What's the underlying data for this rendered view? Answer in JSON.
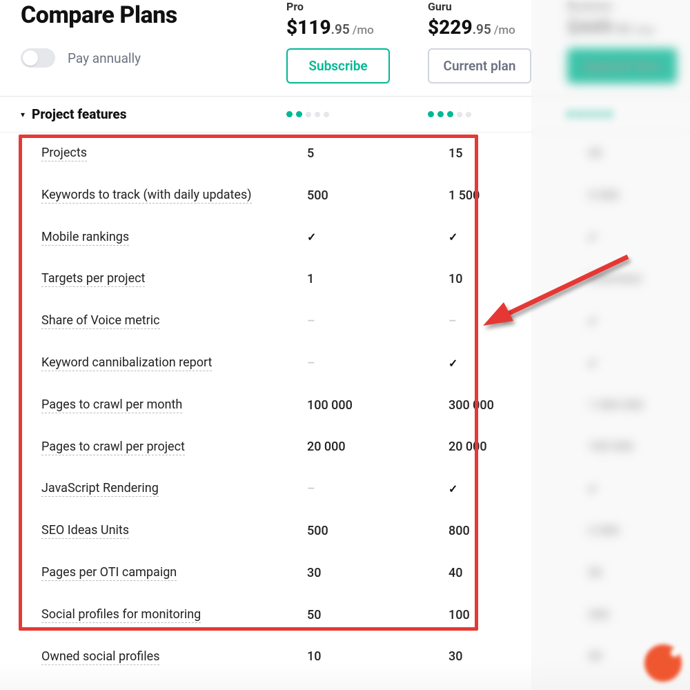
{
  "title": "Compare Plans",
  "annual_toggle_label": "Pay annually",
  "plans": {
    "pro": {
      "name": "Pro",
      "price_main": "$119",
      "price_cents": ".95",
      "period": "/mo",
      "button": "Subscribe",
      "dots_on": 2,
      "dots_total": 5
    },
    "guru": {
      "name": "Guru",
      "price_main": "$229",
      "price_cents": ".95",
      "period": "/mo",
      "button": "Current plan",
      "dots_on": 3,
      "dots_total": 5
    },
    "business": {
      "name": "Business",
      "price_main": "$449",
      "price_cents": ".95",
      "period": "/mo",
      "button": "Upgrade Now",
      "dots_on": 5,
      "dots_total": 5
    }
  },
  "section_title": "Project features",
  "features": [
    {
      "label": "Projects",
      "pro": "5",
      "guru": "15",
      "business": "40"
    },
    {
      "label": "Keywords to track (with daily updates)",
      "pro": "500",
      "guru": "1 500",
      "business": "5 000"
    },
    {
      "label": "Mobile rankings",
      "pro": "check",
      "guru": "check",
      "business": "check"
    },
    {
      "label": "Targets per project",
      "pro": "1",
      "guru": "10",
      "business": "Unlimited"
    },
    {
      "label": "Share of Voice metric",
      "pro": "dash",
      "guru": "dash",
      "business": "check"
    },
    {
      "label": "Keyword cannibalization report",
      "pro": "dash",
      "guru": "check",
      "business": "check"
    },
    {
      "label": "Pages to crawl per month",
      "pro": "100 000",
      "guru": "300 000",
      "business": "1 000 000"
    },
    {
      "label": "Pages to crawl per project",
      "pro": "20 000",
      "guru": "20 000",
      "business": "100 000"
    },
    {
      "label": "JavaScript Rendering",
      "pro": "dash",
      "guru": "check",
      "business": "check"
    },
    {
      "label": "SEO Ideas Units",
      "pro": "500",
      "guru": "800",
      "business": "2 000"
    },
    {
      "label": "Pages per OTI campaign",
      "pro": "30",
      "guru": "40",
      "business": "50"
    },
    {
      "label": "Social profiles for monitoring",
      "pro": "50",
      "guru": "100",
      "business": "300"
    },
    {
      "label": "Owned social profiles",
      "pro": "10",
      "guru": "30",
      "business": "50"
    }
  ]
}
